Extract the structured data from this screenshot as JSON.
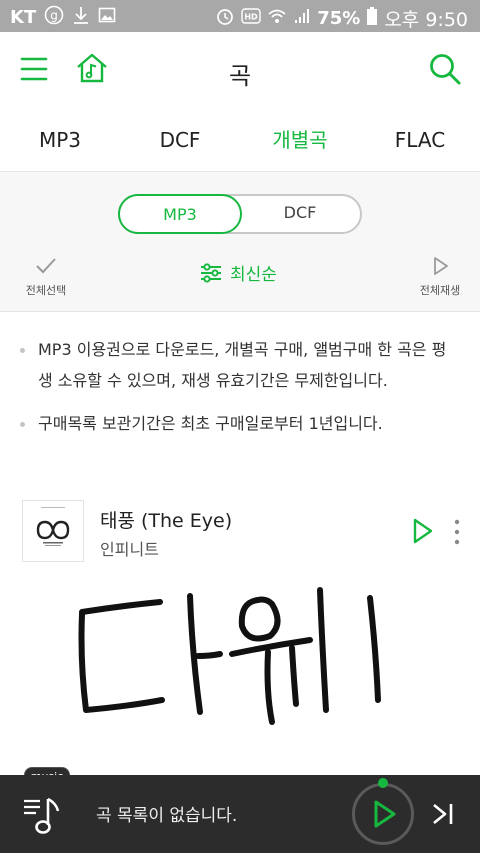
{
  "status_bar": {
    "carrier": "KT",
    "battery": "75%",
    "time": "오후 9:50"
  },
  "header": {
    "title": "곡"
  },
  "tabs": [
    {
      "label": "MP3",
      "active": false
    },
    {
      "label": "DCF",
      "active": false
    },
    {
      "label": "개별곡",
      "active": true
    },
    {
      "label": "FLAC",
      "active": false
    }
  ],
  "segment": {
    "selected": "MP3",
    "other": "DCF"
  },
  "sortbar": {
    "select_all": "전체선택",
    "sort_label": "최신순",
    "play_all": "전체재생"
  },
  "notice": [
    "MP3 이용권으로 다운로드, 개별곡 구매, 앨범구매 한 곡은 평생 소유할 수 있으며, 재생 유효기간은 무제한입니다.",
    "구매목록 보관기간은 최초 구매일로부터 1년입니다."
  ],
  "song": {
    "title": "태풍 (The Eye)",
    "artist": "인피니트"
  },
  "player": {
    "tag": "music",
    "now_playing": "곡 목록이 없습니다."
  },
  "colors": {
    "accent": "#17b840",
    "status_bar": "#a8a8a8",
    "player_bg": "#2c2c2c"
  }
}
